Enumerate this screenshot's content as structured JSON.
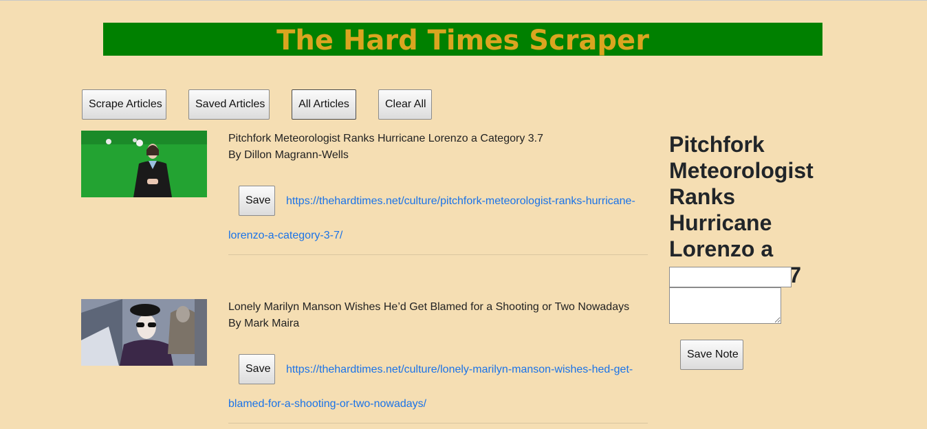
{
  "header": {
    "title": "The Hard Times Scraper"
  },
  "toolbar": {
    "scrape": "Scrape Articles",
    "saved": "Saved Articles",
    "all": "All Articles",
    "clear": "Clear All"
  },
  "articles": [
    {
      "title": "Pitchfork Meteorologist Ranks Hurricane Lorenzo a Category 3.7",
      "author": "By Dillon Magrann-Wells",
      "save_label": "Save",
      "link_line1": "https://thehardtimes.net/culture/pitchfork-meteorologist-ranks-hurricane-",
      "link_line2": "lorenzo-a-category-3-7/",
      "link_href": "https://thehardtimes.net/culture/pitchfork-meteorologist-ranks-hurricane-lorenzo-a-category-3-7/"
    },
    {
      "title": "Lonely Marilyn Manson Wishes He’d Get Blamed for a Shooting or Two Nowadays",
      "author": "By Mark Maira",
      "save_label": "Save",
      "link_line1": "https://thehardtimes.net/culture/lonely-marilyn-manson-wishes-hed-get-",
      "link_line2": "blamed-for-a-shooting-or-two-nowadays/",
      "link_href": "https://thehardtimes.net/culture/lonely-marilyn-manson-wishes-hed-get-blamed-for-a-shooting-or-two-nowadays/"
    }
  ],
  "note_panel": {
    "title": "Pitchfork Meteorologist Ranks Hurricane Lorenzo a Category 3.7",
    "title_input_value": "",
    "body_value": "",
    "save_label": "Save Note"
  },
  "colors": {
    "background": "#f5deb3",
    "banner": "#008000",
    "banner_text": "#daa520",
    "link": "#1a73e8"
  }
}
